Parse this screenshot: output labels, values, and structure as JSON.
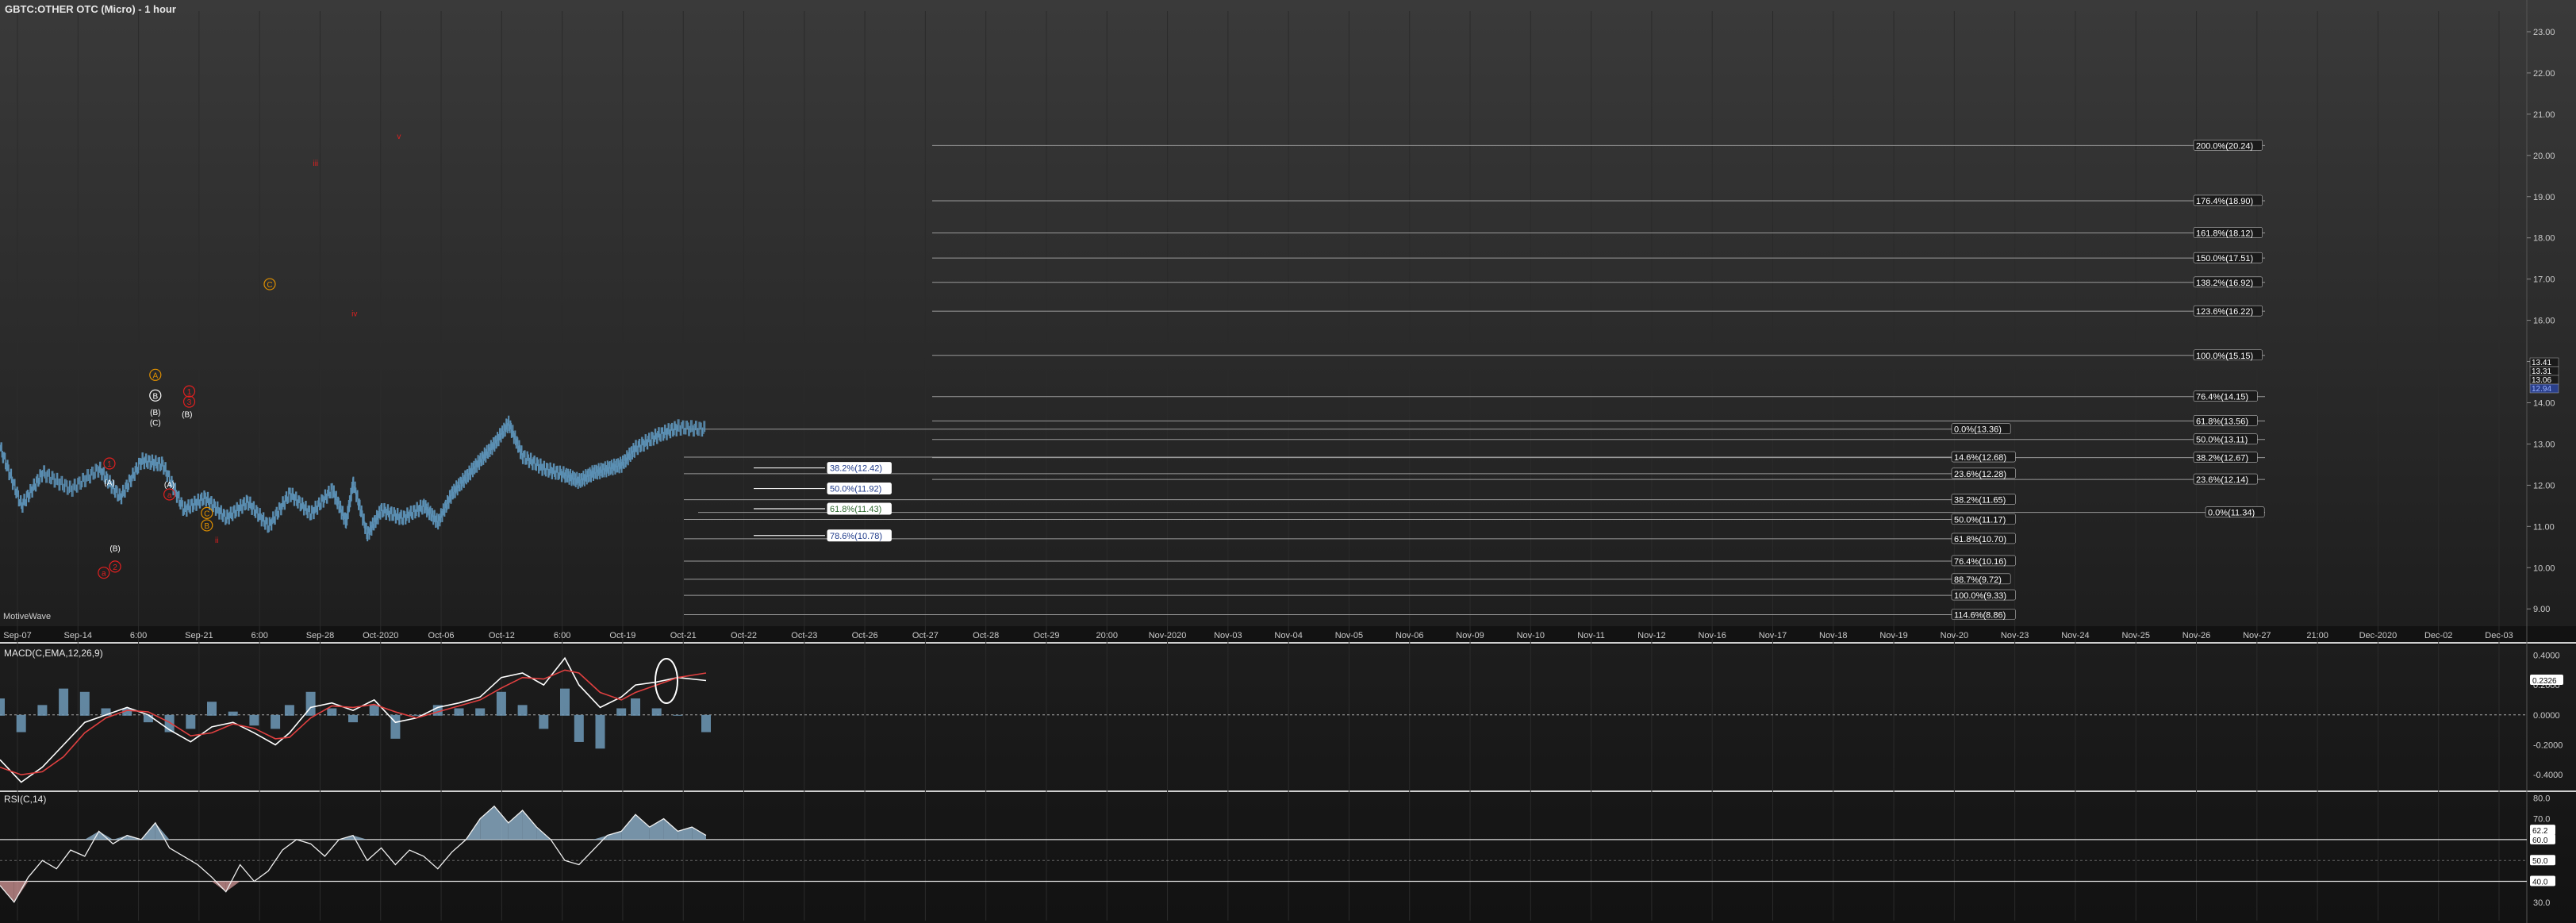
{
  "title": "GBTC:OTHER OTC (Micro) - 1 hour",
  "watermark": "MotiveWave",
  "colors": {
    "price_bars": "#5b8fb3",
    "macd_line": "#ffffff",
    "signal_line": "#e04040",
    "histogram": "#6f9ab8",
    "wave_red": "#e02020",
    "wave_orange": "#e09000",
    "rsi_down": "#c89090",
    "rsi_up": "#8fb2cc"
  },
  "chart_data": [
    {
      "type": "line",
      "panel": "price",
      "x_tick_labels": [
        "Sep-07",
        "Sep-14",
        "6:00",
        "Sep-21",
        "6:00",
        "Sep-28",
        "Oct-2020",
        "Oct-06",
        "Oct-12",
        "6:00",
        "Oct-19",
        "Oct-21",
        "Oct-22",
        "Oct-23",
        "Oct-26",
        "Oct-27",
        "Oct-28",
        "Oct-29",
        "20:00",
        "Nov-2020",
        "Nov-03",
        "Nov-04",
        "Nov-05",
        "Nov-06",
        "Nov-09",
        "Nov-10",
        "Nov-11",
        "Nov-12",
        "Nov-16",
        "Nov-17",
        "Nov-18",
        "Nov-19",
        "Nov-20",
        "Nov-23",
        "Nov-24",
        "Nov-25",
        "Nov-26",
        "Nov-27",
        "21:00",
        "Dec-2020",
        "Dec-02",
        "Dec-03"
      ],
      "y_ticks": [
        "9.00",
        "10.00",
        "11.00",
        "12.00",
        "13.00",
        "14.00",
        "15.00",
        "16.00",
        "17.00",
        "18.00",
        "19.00",
        "20.00",
        "21.00",
        "22.00",
        "23.00"
      ],
      "ylim": [
        8.6,
        23.5
      ],
      "last_price_labels": [
        "13.41",
        "13.31",
        "13.06",
        "12.94"
      ],
      "price_path": [
        [
          0,
          12.9
        ],
        [
          0.03,
          11.5
        ],
        [
          0.06,
          12.3
        ],
        [
          0.1,
          11.9
        ],
        [
          0.14,
          12.4
        ],
        [
          0.17,
          11.7
        ],
        [
          0.2,
          12.6
        ],
        [
          0.23,
          12.5
        ],
        [
          0.26,
          11.4
        ],
        [
          0.29,
          11.7
        ],
        [
          0.32,
          11.2
        ],
        [
          0.35,
          11.6
        ],
        [
          0.38,
          11.0
        ],
        [
          0.41,
          11.8
        ],
        [
          0.44,
          11.3
        ],
        [
          0.47,
          11.9
        ],
        [
          0.49,
          11.1
        ],
        [
          0.5,
          12.05
        ],
        [
          0.52,
          10.8
        ],
        [
          0.54,
          11.4
        ],
        [
          0.57,
          11.2
        ],
        [
          0.6,
          11.5
        ],
        [
          0.62,
          11.1
        ],
        [
          0.64,
          11.8
        ],
        [
          0.66,
          12.2
        ],
        [
          0.68,
          12.6
        ],
        [
          0.7,
          13.0
        ],
        [
          0.72,
          13.5
        ],
        [
          0.74,
          12.7
        ],
        [
          0.77,
          12.4
        ],
        [
          0.8,
          12.25
        ],
        [
          0.82,
          12.1
        ],
        [
          0.84,
          12.3
        ],
        [
          0.86,
          12.4
        ],
        [
          0.88,
          12.5
        ],
        [
          0.9,
          12.9
        ],
        [
          0.93,
          13.2
        ],
        [
          0.96,
          13.4
        ],
        [
          1.0,
          13.36
        ]
      ],
      "fib_levels_a": [
        {
          "label": "200.0%(20.24)",
          "price": 20.24
        },
        {
          "label": "176.4%(18.90)",
          "price": 18.9
        },
        {
          "label": "161.8%(18.12)",
          "price": 18.12
        },
        {
          "label": "150.0%(17.51)",
          "price": 17.51
        },
        {
          "label": "138.2%(16.92)",
          "price": 16.92
        },
        {
          "label": "123.6%(16.22)",
          "price": 16.22
        },
        {
          "label": "100.0%(15.15)",
          "price": 15.15
        },
        {
          "label": "76.4%(14.15)",
          "price": 14.15
        },
        {
          "label": "61.8%(13.56)",
          "price": 13.56
        },
        {
          "label": "50.0%(13.11)",
          "price": 13.11
        },
        {
          "label": "38.2%(12.67)",
          "price": 12.67
        },
        {
          "label": "23.6%(12.14)",
          "price": 12.14
        }
      ],
      "fib_levels_b": [
        {
          "label": "0.0%(13.36)",
          "price": 13.36
        },
        {
          "label": "14.6%(12.68)",
          "price": 12.68
        },
        {
          "label": "23.6%(12.28)",
          "price": 12.28
        },
        {
          "label": "38.2%(11.65)",
          "price": 11.65
        },
        {
          "label": "50.0%(11.17)",
          "price": 11.17
        },
        {
          "label": "61.8%(10.70)",
          "price": 10.7
        },
        {
          "label": "76.4%(10.16)",
          "price": 10.16
        },
        {
          "label": "88.7%(9.72)",
          "price": 9.72
        },
        {
          "label": "100.0%(9.33)",
          "price": 9.33
        },
        {
          "label": "114.6%(8.86)",
          "price": 8.86
        }
      ],
      "fib_level_c": {
        "label": "0.0%(11.34)",
        "price": 11.34
      },
      "fib_levels_d": [
        {
          "label": "38.2%(12.42)",
          "price": 12.42
        },
        {
          "label": "50.0%(11.92)",
          "price": 11.92
        },
        {
          "label": "61.8%(11.43)",
          "price": 11.43
        },
        {
          "label": "78.6%(10.78)",
          "price": 10.78
        }
      ],
      "wave_labels": [
        {
          "text": "1",
          "price": 12.45,
          "t": 0.155
        },
        {
          "text": "(A)",
          "price": 12.0,
          "t": 0.155
        },
        {
          "text": "a",
          "price": 9.8,
          "t": 0.147
        },
        {
          "text": "2",
          "price": 9.95,
          "t": 0.163
        },
        {
          "text": "(B)",
          "price": 10.4,
          "t": 0.163
        },
        {
          "text": "A",
          "price": 14.6,
          "t": 0.22
        },
        {
          "text": "B",
          "price": 14.1,
          "t": 0.22
        },
        {
          "text": "(B)",
          "price": 13.7,
          "t": 0.22
        },
        {
          "text": "(C)",
          "price": 13.45,
          "t": 0.22
        },
        {
          "text": "(A)",
          "price": 11.95,
          "t": 0.24
        },
        {
          "text": "a",
          "price": 11.7,
          "t": 0.24
        },
        {
          "text": "(B)",
          "price": 13.65,
          "t": 0.265
        },
        {
          "text": "3",
          "price": 13.95,
          "t": 0.268
        },
        {
          "text": "1",
          "price": 14.2,
          "t": 0.268
        },
        {
          "text": "C",
          "price": 11.25,
          "t": 0.293
        },
        {
          "text": "B",
          "price": 10.95,
          "t": 0.293
        },
        {
          "text": "ii",
          "price": 10.6,
          "t": 0.307
        },
        {
          "text": "C",
          "price": 16.8,
          "t": 0.382
        },
        {
          "text": "iii",
          "price": 19.75,
          "t": 0.447
        },
        {
          "text": "iv",
          "price": 16.1,
          "t": 0.502
        },
        {
          "text": "v",
          "price": 20.4,
          "t": 0.565
        }
      ]
    },
    {
      "type": "line",
      "panel": "macd",
      "title": "MACD(C,EMA,12,26,9)",
      "y_ticks": [
        "0.4000",
        "0.2000",
        "0.0000",
        "-0.2000",
        "-0.4000"
      ],
      "ylim": [
        -0.5,
        0.45
      ],
      "current_value": "0.2326",
      "macd": [
        [
          0,
          -0.3
        ],
        [
          0.03,
          -0.45
        ],
        [
          0.06,
          -0.35
        ],
        [
          0.09,
          -0.2
        ],
        [
          0.12,
          -0.05
        ],
        [
          0.15,
          0.0
        ],
        [
          0.18,
          0.05
        ],
        [
          0.21,
          0.0
        ],
        [
          0.24,
          -0.1
        ],
        [
          0.27,
          -0.18
        ],
        [
          0.3,
          -0.08
        ],
        [
          0.33,
          -0.05
        ],
        [
          0.36,
          -0.12
        ],
        [
          0.39,
          -0.2
        ],
        [
          0.41,
          -0.12
        ],
        [
          0.44,
          0.05
        ],
        [
          0.47,
          0.08
        ],
        [
          0.5,
          0.03
        ],
        [
          0.53,
          0.1
        ],
        [
          0.56,
          -0.05
        ],
        [
          0.59,
          -0.02
        ],
        [
          0.62,
          0.05
        ],
        [
          0.65,
          0.08
        ],
        [
          0.68,
          0.12
        ],
        [
          0.71,
          0.25
        ],
        [
          0.74,
          0.28
        ],
        [
          0.77,
          0.2
        ],
        [
          0.8,
          0.38
        ],
        [
          0.82,
          0.2
        ],
        [
          0.85,
          0.05
        ],
        [
          0.88,
          0.12
        ],
        [
          0.9,
          0.2
        ],
        [
          0.93,
          0.22
        ],
        [
          0.96,
          0.25
        ],
        [
          1.0,
          0.23
        ]
      ],
      "signal": [
        [
          0,
          -0.35
        ],
        [
          0.03,
          -0.4
        ],
        [
          0.06,
          -0.38
        ],
        [
          0.09,
          -0.28
        ],
        [
          0.12,
          -0.12
        ],
        [
          0.15,
          -0.02
        ],
        [
          0.18,
          0.03
        ],
        [
          0.21,
          0.02
        ],
        [
          0.24,
          -0.05
        ],
        [
          0.27,
          -0.14
        ],
        [
          0.3,
          -0.12
        ],
        [
          0.33,
          -0.06
        ],
        [
          0.36,
          -0.09
        ],
        [
          0.39,
          -0.16
        ],
        [
          0.41,
          -0.15
        ],
        [
          0.44,
          -0.02
        ],
        [
          0.47,
          0.06
        ],
        [
          0.5,
          0.05
        ],
        [
          0.53,
          0.07
        ],
        [
          0.56,
          0.02
        ],
        [
          0.59,
          -0.02
        ],
        [
          0.62,
          0.02
        ],
        [
          0.65,
          0.06
        ],
        [
          0.68,
          0.1
        ],
        [
          0.71,
          0.18
        ],
        [
          0.74,
          0.25
        ],
        [
          0.77,
          0.24
        ],
        [
          0.8,
          0.3
        ],
        [
          0.82,
          0.28
        ],
        [
          0.85,
          0.15
        ],
        [
          0.88,
          0.1
        ],
        [
          0.9,
          0.15
        ],
        [
          0.93,
          0.2
        ],
        [
          0.96,
          0.25
        ],
        [
          1.0,
          0.28
        ]
      ]
    },
    {
      "type": "line",
      "panel": "rsi",
      "title": "RSI(C,14)",
      "y_ticks": [
        "80.0",
        "70.0",
        "60.0",
        "50.0",
        "40.0",
        "30.0"
      ],
      "ylim": [
        25,
        82
      ],
      "levels": [
        60,
        40
      ],
      "value_labels": [
        "62.2",
        "60.0",
        "50.0",
        "40.0"
      ],
      "rsi": [
        [
          0,
          38
        ],
        [
          0.02,
          30
        ],
        [
          0.04,
          42
        ],
        [
          0.06,
          50
        ],
        [
          0.08,
          46
        ],
        [
          0.1,
          55
        ],
        [
          0.12,
          52
        ],
        [
          0.14,
          64
        ],
        [
          0.16,
          58
        ],
        [
          0.18,
          62
        ],
        [
          0.2,
          60
        ],
        [
          0.22,
          68
        ],
        [
          0.24,
          56
        ],
        [
          0.26,
          52
        ],
        [
          0.28,
          48
        ],
        [
          0.3,
          42
        ],
        [
          0.32,
          35
        ],
        [
          0.34,
          48
        ],
        [
          0.36,
          40
        ],
        [
          0.38,
          45
        ],
        [
          0.4,
          55
        ],
        [
          0.42,
          60
        ],
        [
          0.44,
          58
        ],
        [
          0.46,
          52
        ],
        [
          0.48,
          60
        ],
        [
          0.5,
          62
        ],
        [
          0.52,
          50
        ],
        [
          0.54,
          56
        ],
        [
          0.56,
          48
        ],
        [
          0.58,
          55
        ],
        [
          0.6,
          52
        ],
        [
          0.62,
          46
        ],
        [
          0.64,
          54
        ],
        [
          0.66,
          60
        ],
        [
          0.68,
          70
        ],
        [
          0.7,
          76
        ],
        [
          0.72,
          68
        ],
        [
          0.74,
          74
        ],
        [
          0.76,
          66
        ],
        [
          0.78,
          60
        ],
        [
          0.8,
          50
        ],
        [
          0.82,
          48
        ],
        [
          0.84,
          55
        ],
        [
          0.86,
          62
        ],
        [
          0.88,
          64
        ],
        [
          0.9,
          72
        ],
        [
          0.92,
          66
        ],
        [
          0.94,
          70
        ],
        [
          0.96,
          64
        ],
        [
          0.98,
          66
        ],
        [
          1.0,
          62
        ]
      ]
    }
  ]
}
